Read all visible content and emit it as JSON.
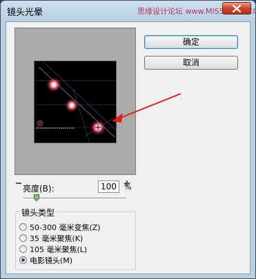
{
  "window": {
    "title": "镜头光晕",
    "watermark": "思缘设计论坛 www.MISSYUAN.COM"
  },
  "buttons": {
    "ok_label": "确定",
    "cancel_label": "取消"
  },
  "brightness": {
    "label": "亮度(B):",
    "value": "100",
    "unit": "%",
    "slider_fraction": 0.12
  },
  "lens_type": {
    "title": "镜头类型",
    "options": [
      {
        "label": "50-300 毫米变焦(Z)",
        "selected": false
      },
      {
        "label": "35 毫米聚焦(K)",
        "selected": false
      },
      {
        "label": "105 毫米聚焦(L)",
        "selected": false
      },
      {
        "label": "电影镜头(M)",
        "selected": true
      }
    ]
  },
  "colors": {
    "annotation_arrow": "#e21b1b",
    "title_bar": "#b9cfe4",
    "selected_radio": "#1c4d80"
  }
}
